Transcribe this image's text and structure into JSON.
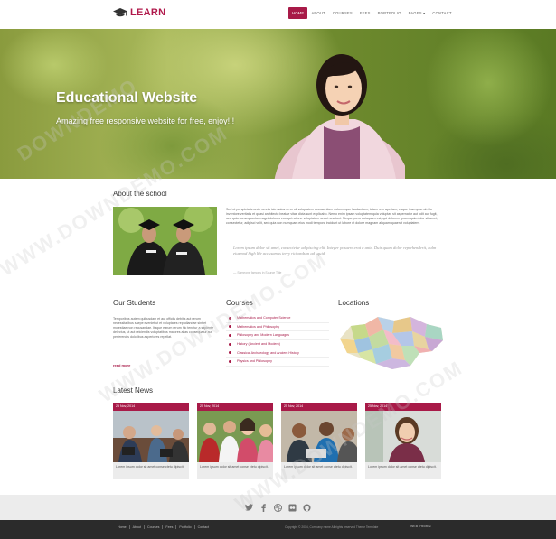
{
  "brand": {
    "logo_text": "LEARN"
  },
  "nav": {
    "items": [
      {
        "label": "HOME",
        "active": true
      },
      {
        "label": "ABOUT"
      },
      {
        "label": "COURSES"
      },
      {
        "label": "FEES"
      },
      {
        "label": "PORTFOLIO"
      },
      {
        "label": "PAGES ▾"
      },
      {
        "label": "CONTACT"
      }
    ]
  },
  "hero": {
    "title": "Educational Website",
    "subtitle": "Amazing free responsive website for free, enjoy!!!"
  },
  "about": {
    "title": "About the school",
    "text": "Sed ut perspiciatis unde omnis iste natus error sit voluptatem accusantium doloremque laudantium, totam rem aperiam, eaque ipsa quae ab illo inventore veritatis et quasi architecto beatae vitae dicta sunt explicabo. Nemo enim ipsam voluptatem quia voluptas sit aspernatur aut odit aut fugit, sed quia consequuntur magni dolores eos qui ratione voluptatem sequi nesciunt. Neque porro quisquam est, qui dolorem ipsum quia dolor sit amet, consectetur, adipisci velit, sed quia non numquam eius modi tempora incidunt ut labore et dolore magnam aliquam quaerat voluptatem.",
    "quote": "Lorem ipsum dolor sit amet, consectetur adipiscing elit. Integer posuere erat a ante. Duis quam dolor reprehenderit, culm eiusmod high life accusamus terry richardson ad squid.",
    "quote_author": "— Someone famous in Source Title"
  },
  "students": {
    "title": "Our Students",
    "text": "Temporibus autem quibusdam et aut officiis debitis aut rerum necessitatibus saepe eveniet ut et voluptates repudiandae sint et molestiae non recusandae. Itaque earum rerum hic tenetur a sapiente delectus, ut aut reiciendis voluptatibus maiores alias consequatur aut perferendis doloribus asperiores repellat.",
    "read_more": "read more"
  },
  "courses": {
    "title": "Courses",
    "items": [
      "Mathematics and Computer Science",
      "Mathematics and Philosophy",
      "Philosophy and Modern Languages",
      "History (Ancient and Modern)",
      "Classical Archaeology and Ancient History",
      "Physics and Philosophy"
    ]
  },
  "locations": {
    "title": "Locations"
  },
  "news": {
    "title": "Latest News",
    "cards": [
      {
        "date": "25 Nov, 2014",
        "caption": "Lorem ipsum dolor sit amet conse ctetu dipiscit."
      },
      {
        "date": "25 Nov, 2014",
        "caption": "Lorem ipsum dolor sit amet conse ctetu dipiscit."
      },
      {
        "date": "25 Nov, 2014",
        "caption": "Lorem ipsum dolor sit amet conse ctetu dipiscit."
      },
      {
        "date": "25 Nov, 2014",
        "caption": "Lorem ipsum dolor sit amet conse ctetu dipiscit."
      }
    ]
  },
  "social": {
    "icons": [
      "twitter-icon",
      "facebook-icon",
      "dribbble-icon",
      "flickr-icon",
      "github-icon"
    ]
  },
  "footer": {
    "links": [
      "Home",
      "About",
      "Courses",
      "Fees",
      "Portfolio",
      "Contact"
    ],
    "copyright": "Copyright © 2014, Company name All rights reserved Theme Template",
    "brand": "WEBTHEMEZ"
  },
  "colors": {
    "accent": "#a81a48",
    "footer": "#2b2b2b",
    "footer_top": "#ececec"
  }
}
